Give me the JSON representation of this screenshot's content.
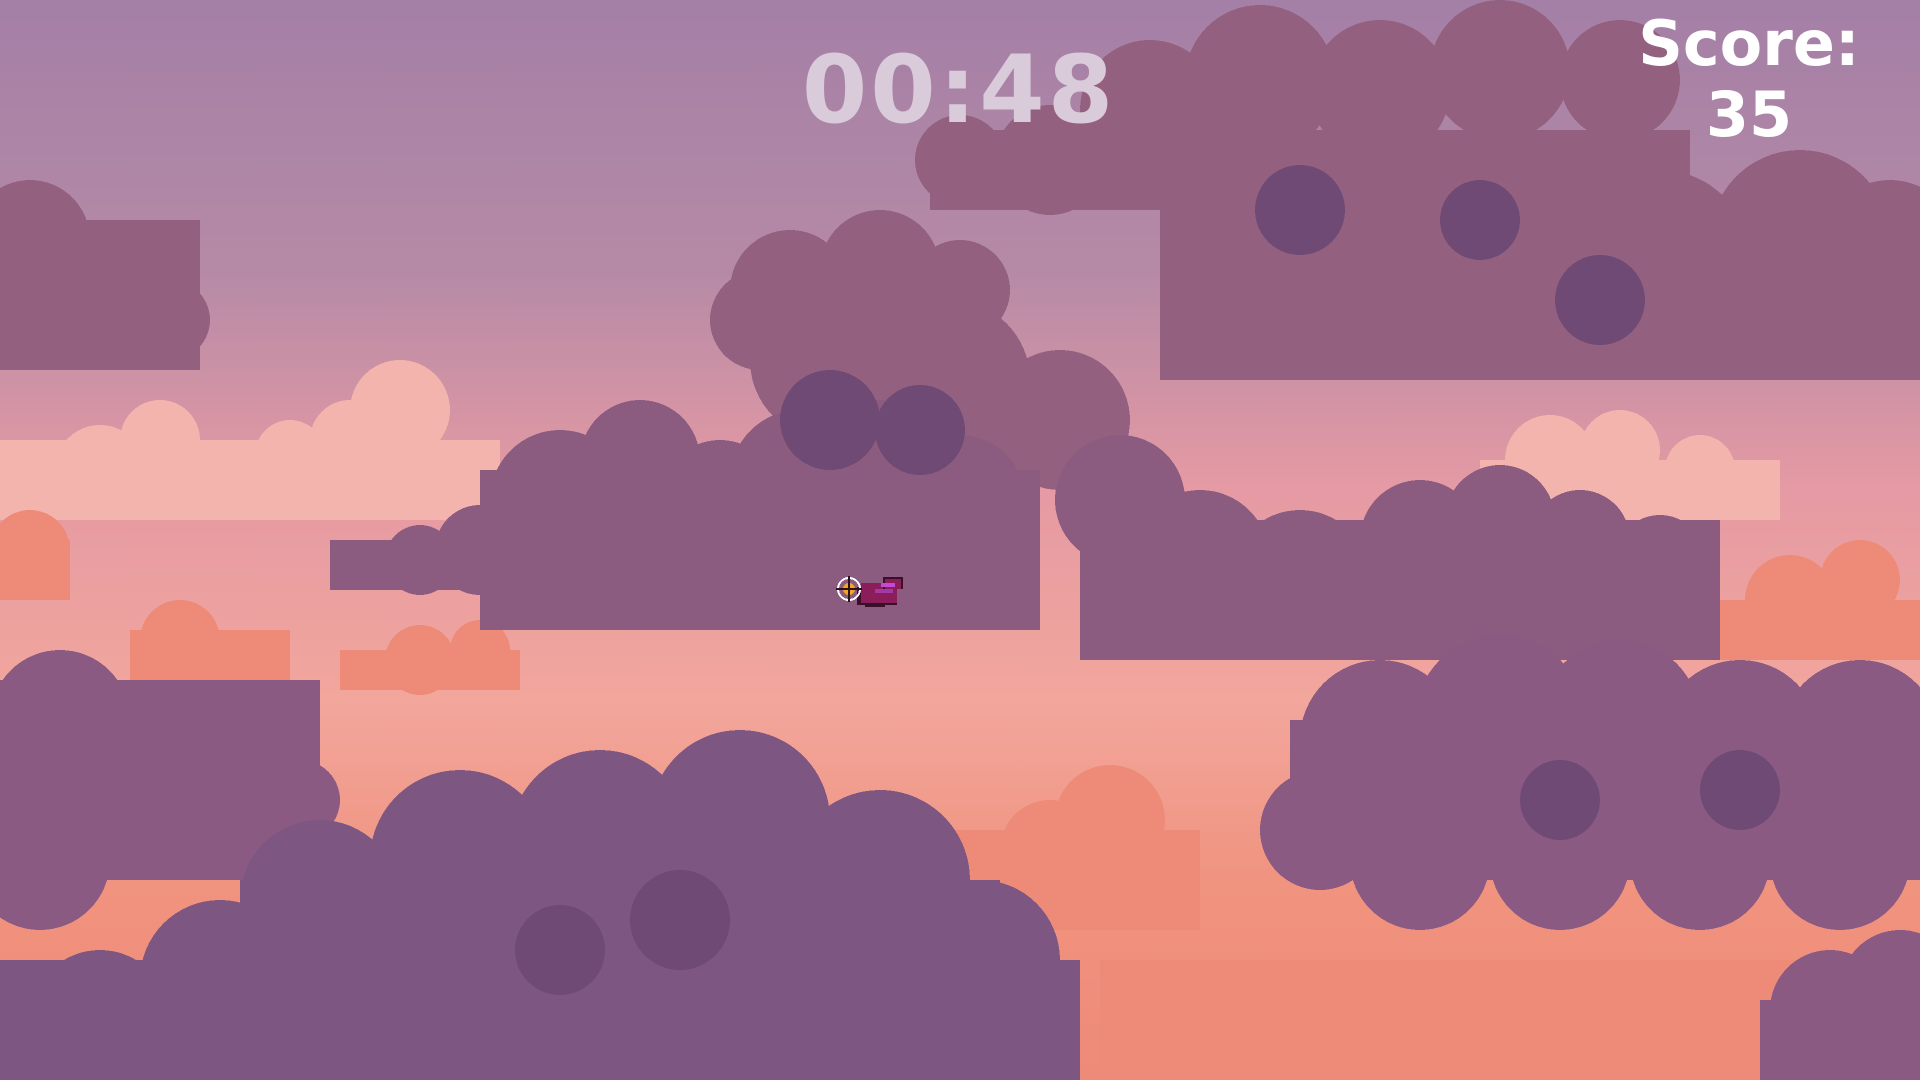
{
  "hud": {
    "timer": "00:48",
    "score_label": "Score:",
    "score_value": "35"
  },
  "player": {
    "icon": "crosshair-icon",
    "sprite": "red-bird-sprite"
  },
  "colors": {
    "sky_top": "#a47fa6",
    "sky_mid": "#e59aa4",
    "sky_bottom": "#f0937f",
    "cloud_dark": "#7d5682",
    "cloud_mid": "#94607f",
    "cloud_light": "#b9808f",
    "cloud_orange": "#ee8a78",
    "timer_text": "#d9cbd9",
    "score_text": "#ffffff"
  }
}
